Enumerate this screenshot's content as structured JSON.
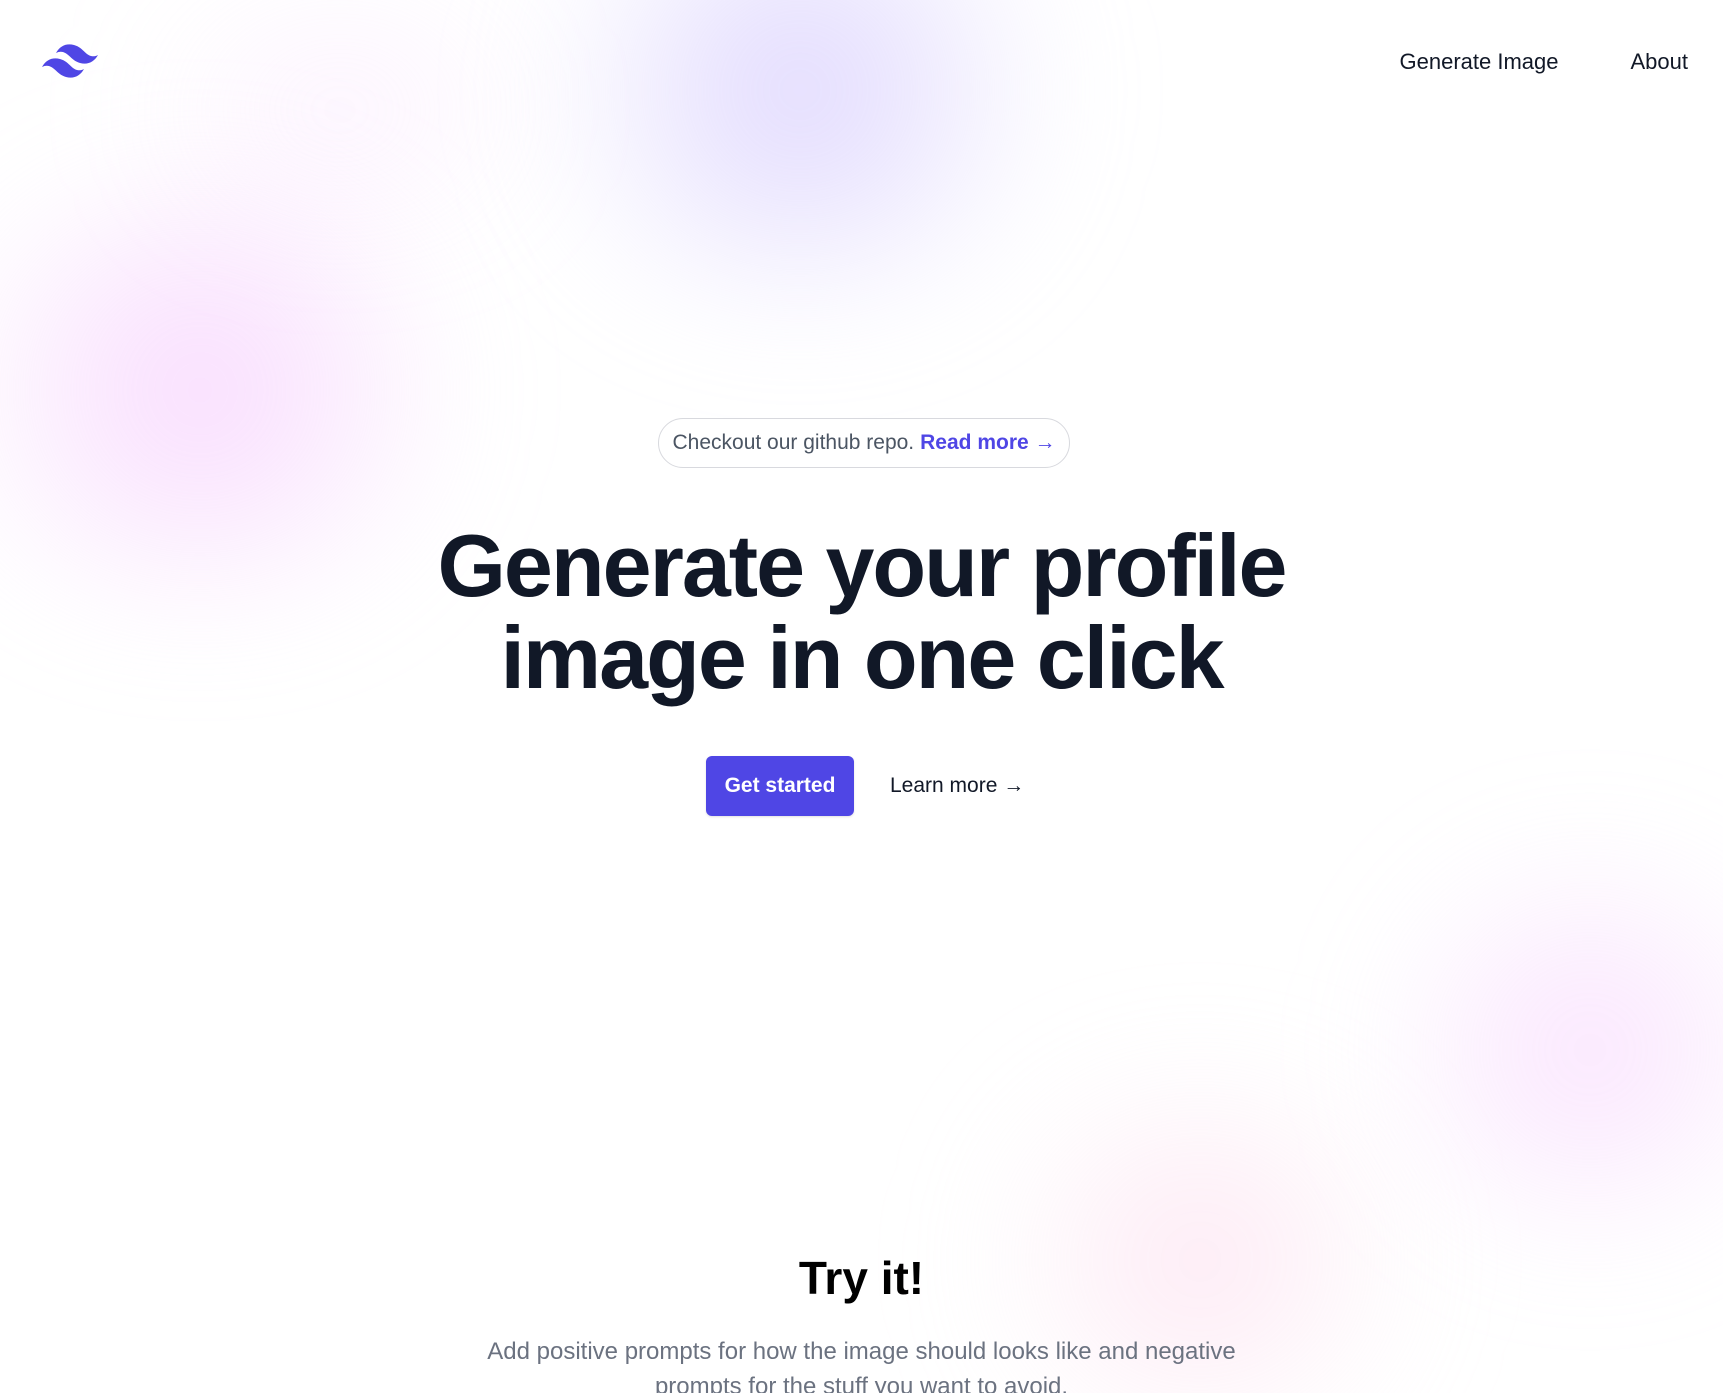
{
  "nav": {
    "logo_icon": "tailwind-wave-icon",
    "items": [
      {
        "label": "Generate Image"
      },
      {
        "label": "About"
      }
    ]
  },
  "hero": {
    "badge": {
      "text": "Checkout our github repo.",
      "link_label": "Read more →"
    },
    "headline": "Generate your profile image in one click",
    "actions": {
      "primary_label": "Get started",
      "secondary_label": "Learn more →"
    }
  },
  "try_section": {
    "title": "Try it!",
    "description": "Add positive prompts for how the image should looks like and negative prompts for the stuff you want to avoid."
  },
  "colors": {
    "accent": "#4f46e5",
    "heading": "#111827",
    "muted_text": "#6b7280",
    "background": "#ffffff"
  }
}
